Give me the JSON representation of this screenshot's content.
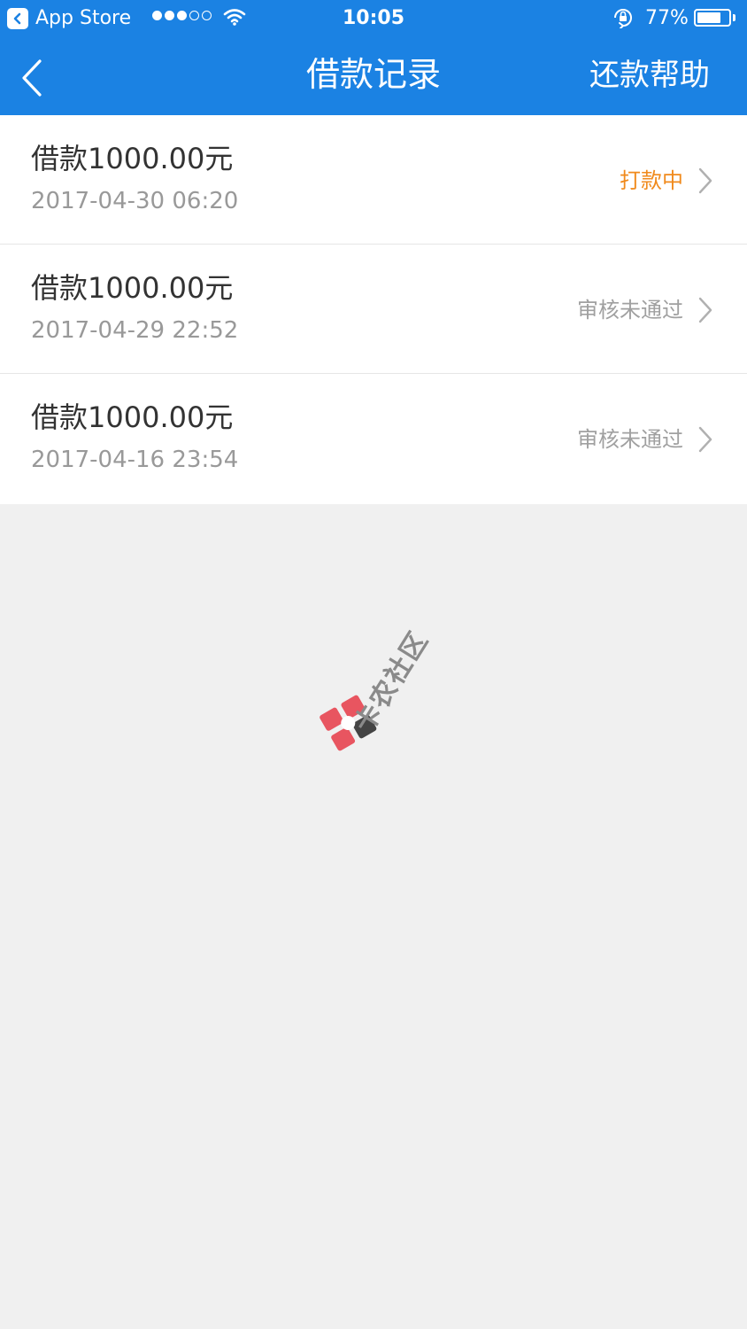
{
  "status_bar": {
    "back_app_label": "App Store",
    "time": "10:05",
    "battery_percent": "77%",
    "battery_level": 0.77,
    "signal_bars_filled": 3,
    "signal_bars_total": 5
  },
  "nav": {
    "title": "借款记录",
    "help_label": "还款帮助",
    "back_icon": "chevron-left-icon"
  },
  "records": [
    {
      "amount": "借款1000.00元",
      "date": "2017-04-30 06:20",
      "status": "打款中",
      "status_color": "#f08a1c"
    },
    {
      "amount": "借款1000.00元",
      "date": "2017-04-29 22:52",
      "status": "审核未通过",
      "status_color": "#a0a0a0"
    },
    {
      "amount": "借款1000.00元",
      "date": "2017-04-16 23:54",
      "status": "审核未通过",
      "status_color": "#a0a0a0"
    }
  ],
  "watermark": {
    "text": "卡农社区"
  },
  "colors": {
    "accent": "#1b82e3",
    "background": "#f0f0f0"
  }
}
